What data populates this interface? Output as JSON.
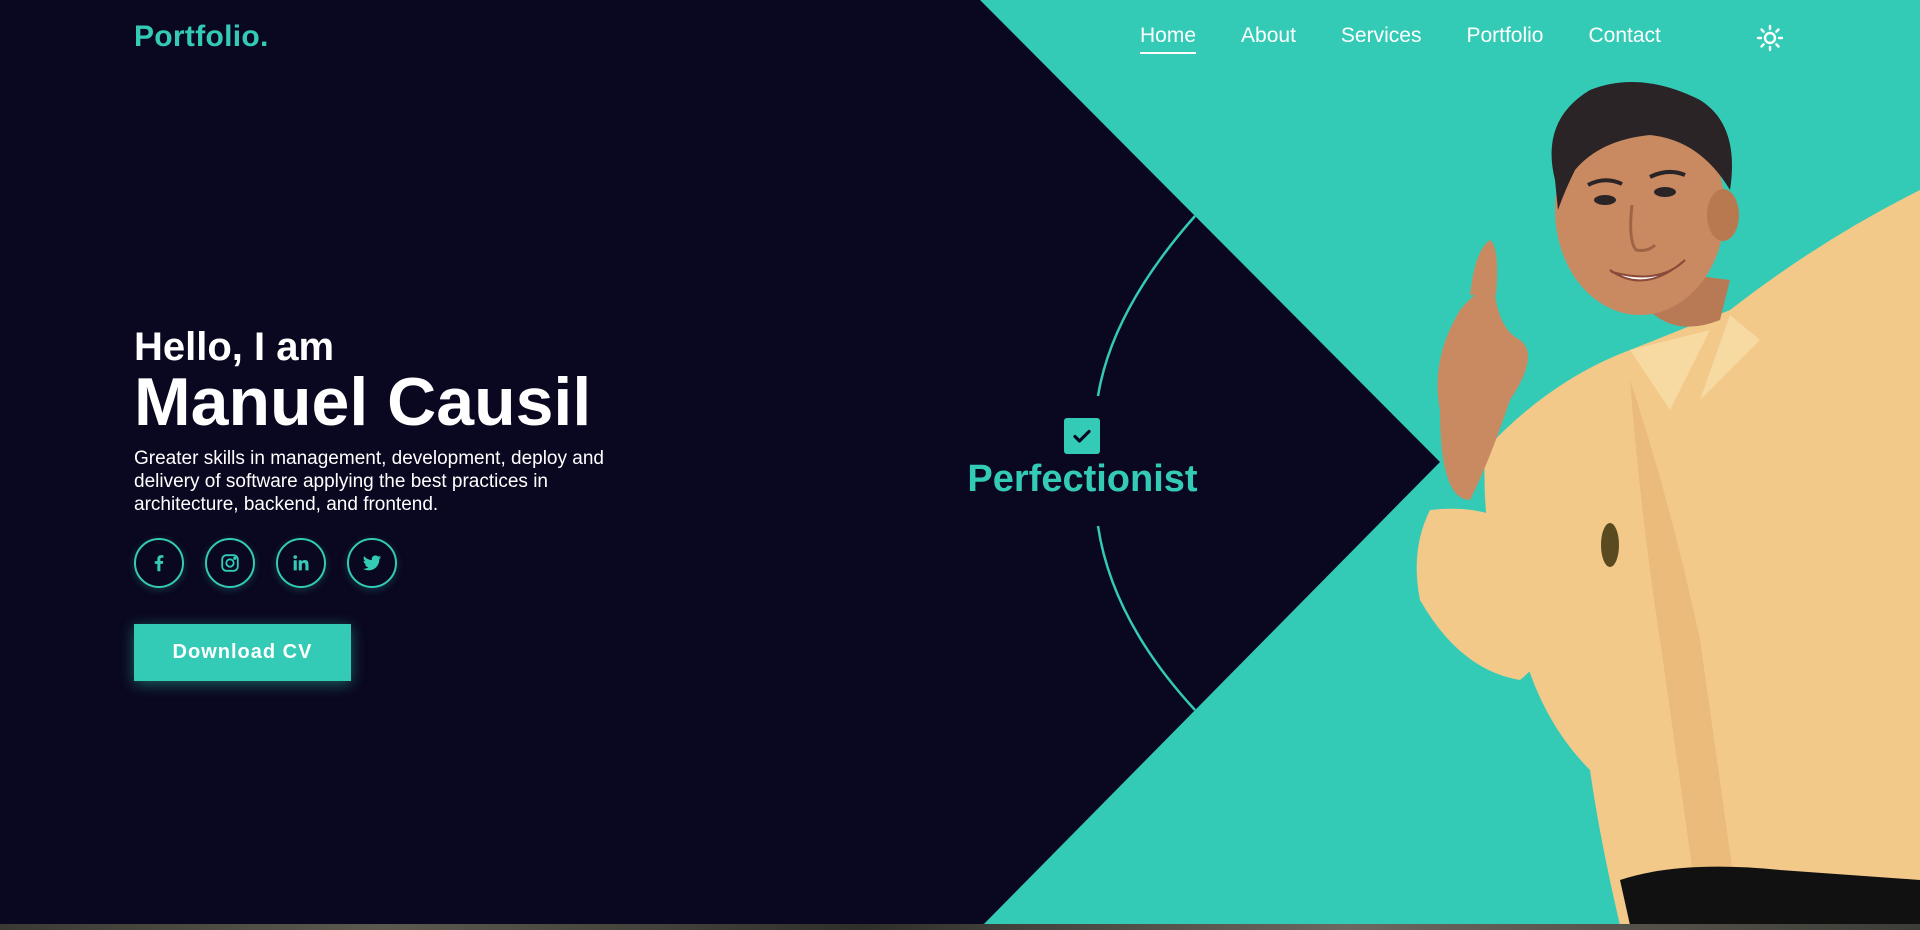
{
  "header": {
    "logo": "Portfolio.",
    "nav": [
      "Home",
      "About",
      "Services",
      "Portfolio",
      "Contact"
    ],
    "active_nav": "Home",
    "theme_icon": "sun-icon"
  },
  "hero": {
    "greeting": "Hello, I am",
    "name": "Manuel Causil",
    "description": "Greater skills in management, development, deploy and delivery of software applying the best practices in architecture, backend, and frontend.",
    "socials": [
      "facebook-icon",
      "instagram-icon",
      "linkedin-icon",
      "twitter-icon"
    ],
    "cta_label": "Download CV"
  },
  "badge": {
    "icon": "check-icon",
    "label": "Perfectionist"
  },
  "colors": {
    "accent": "#34cbb6",
    "background": "#0a0720",
    "text": "#ffffff",
    "shirt": "#f3c98a",
    "skin": "#c98a62",
    "hair": "#2a2426"
  }
}
